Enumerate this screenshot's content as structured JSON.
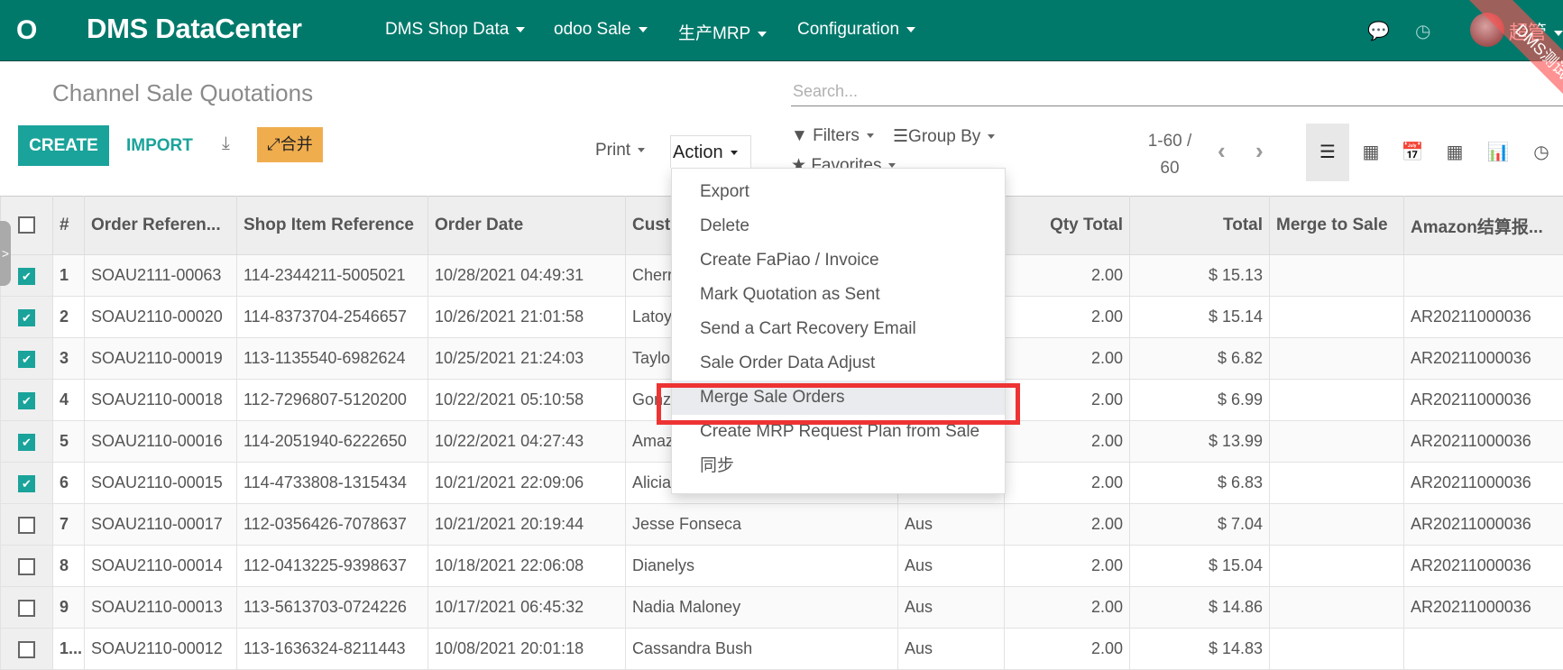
{
  "app": {
    "brand": "DMS DataCenter",
    "logo_icon": "odoo-logo-icon",
    "menus": [
      "DMS Shop Data",
      "odoo Sale",
      "生产MRP",
      "Configuration"
    ],
    "user": "超管",
    "ribbon": "DMS测试"
  },
  "page": {
    "title": "Channel Sale Quotations",
    "create_label": "CREATE",
    "import_label": "IMPORT",
    "merge_label": "合并",
    "print_label": "Print",
    "action_label": "Action"
  },
  "search": {
    "placeholder": "Search...",
    "filters_label": "Filters",
    "groupby_label": "Group By",
    "favorites_label": "Favorites"
  },
  "pager": {
    "range": "1-60 /",
    "total": "60"
  },
  "views": [
    "list",
    "kanban",
    "calendar",
    "pivot",
    "graph",
    "activity"
  ],
  "action_menu": [
    "Export",
    "Delete",
    "Create FaPiao / Invoice",
    "Mark Quotation as Sent",
    "Send a Cart Recovery Email",
    "Sale Order Data Adjust",
    "Merge Sale Orders",
    "Create MRP Request Plan from Sale",
    "同步"
  ],
  "highlighted_action": "Merge Sale Orders",
  "table": {
    "columns": [
      "#",
      "Order Referen...",
      "Shop Item Reference",
      "Order Date",
      "Customer",
      "",
      "Qty Total",
      "Total",
      "Merge to Sale",
      "Amazon结算报..."
    ],
    "rows": [
      {
        "checked": true,
        "n": "1",
        "ref": "SOAU2111-00063",
        "shop": "114-2344211-5005021",
        "date": "10/28/2021 04:49:31",
        "customer": "Cherr",
        "country": "",
        "qty": "2.00",
        "total": "$ 15.13",
        "merge": "",
        "amazon": ""
      },
      {
        "checked": true,
        "n": "2",
        "ref": "SOAU2110-00020",
        "shop": "114-8373704-2546657",
        "date": "10/26/2021 21:01:58",
        "customer": "Latoy",
        "country": "",
        "qty": "2.00",
        "total": "$ 15.14",
        "merge": "",
        "amazon": "AR20211000036"
      },
      {
        "checked": true,
        "n": "3",
        "ref": "SOAU2110-00019",
        "shop": "113-1135540-6982624",
        "date": "10/25/2021 21:24:03",
        "customer": "Taylo",
        "country": "",
        "qty": "2.00",
        "total": "$ 6.82",
        "merge": "",
        "amazon": "AR20211000036"
      },
      {
        "checked": true,
        "n": "4",
        "ref": "SOAU2110-00018",
        "shop": "112-7296807-5120200",
        "date": "10/22/2021 05:10:58",
        "customer": "Gonz",
        "country": "",
        "qty": "2.00",
        "total": "$ 6.99",
        "merge": "",
        "amazon": "AR20211000036"
      },
      {
        "checked": true,
        "n": "5",
        "ref": "SOAU2110-00016",
        "shop": "114-2051940-6222650",
        "date": "10/22/2021 04:27:43",
        "customer": "Amaz",
        "country": "",
        "qty": "2.00",
        "total": "$ 13.99",
        "merge": "",
        "amazon": "AR20211000036"
      },
      {
        "checked": true,
        "n": "6",
        "ref": "SOAU2110-00015",
        "shop": "114-4733808-1315434",
        "date": "10/21/2021 22:09:06",
        "customer": "Alicia",
        "country": "",
        "qty": "2.00",
        "total": "$ 6.83",
        "merge": "",
        "amazon": "AR20211000036"
      },
      {
        "checked": false,
        "n": "7",
        "ref": "SOAU2110-00017",
        "shop": "112-0356426-7078637",
        "date": "10/21/2021 20:19:44",
        "customer": "Jesse Fonseca",
        "country": "Aus",
        "qty": "2.00",
        "total": "$ 7.04",
        "merge": "",
        "amazon": "AR20211000036"
      },
      {
        "checked": false,
        "n": "8",
        "ref": "SOAU2110-00014",
        "shop": "112-0413225-9398637",
        "date": "10/18/2021 22:06:08",
        "customer": "Dianelys",
        "country": "Aus",
        "qty": "2.00",
        "total": "$ 15.04",
        "merge": "",
        "amazon": "AR20211000036"
      },
      {
        "checked": false,
        "n": "9",
        "ref": "SOAU2110-00013",
        "shop": "113-5613703-0724226",
        "date": "10/17/2021 06:45:32",
        "customer": "Nadia Maloney",
        "country": "Aus",
        "qty": "2.00",
        "total": "$ 14.86",
        "merge": "",
        "amazon": "AR20211000036"
      },
      {
        "checked": false,
        "n": "1...",
        "ref": "SOAU2110-00012",
        "shop": "113-1636324-8211443",
        "date": "10/08/2021 20:01:18",
        "customer": "Cassandra Bush",
        "country": "Aus",
        "qty": "2.00",
        "total": "$ 14.83",
        "merge": "",
        "amazon": ""
      }
    ]
  },
  "colors": {
    "navbar": "#00796b",
    "primary": "#1aa39a",
    "merge_button": "#f0ad4e",
    "highlight_box": "#ee3333"
  }
}
